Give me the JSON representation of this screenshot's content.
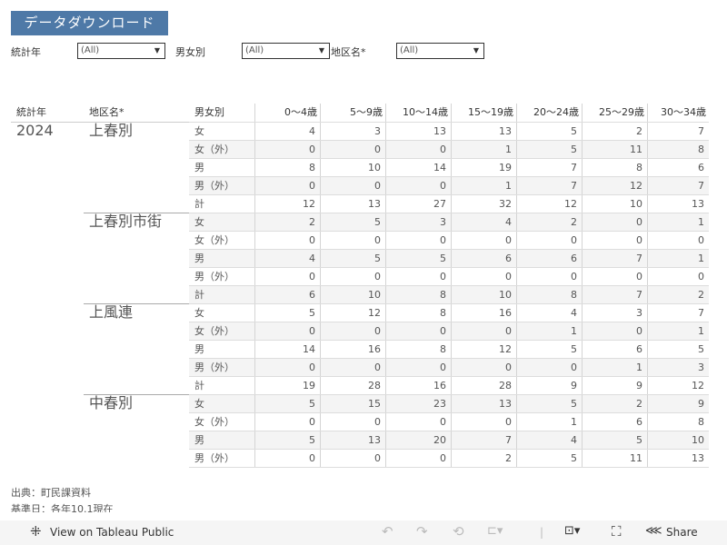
{
  "title_button": "データダウンロード",
  "filters": [
    {
      "label": "統計年",
      "value": "(All)"
    },
    {
      "label": "男女別",
      "value": "(All)"
    },
    {
      "label": "地区名*",
      "value": "(All)"
    }
  ],
  "table": {
    "headers": [
      "統計年",
      "地区名*",
      "男女別",
      "0～4歳",
      "5～9歳",
      "10～14歳",
      "15～19歳",
      "20～24歳",
      "25～29歳",
      "30～34歳"
    ],
    "year": "2024",
    "groups": [
      {
        "district": "上春別",
        "rows": [
          {
            "gender": "女",
            "values": [
              4,
              3,
              13,
              13,
              5,
              2,
              7
            ]
          },
          {
            "gender": "女（外）",
            "values": [
              0,
              0,
              0,
              1,
              5,
              11,
              8
            ]
          },
          {
            "gender": "男",
            "values": [
              8,
              10,
              14,
              19,
              7,
              8,
              6
            ]
          },
          {
            "gender": "男（外）",
            "values": [
              0,
              0,
              0,
              1,
              7,
              12,
              7
            ]
          },
          {
            "gender": "計",
            "values": [
              12,
              13,
              27,
              32,
              12,
              10,
              13
            ]
          }
        ]
      },
      {
        "district": "上春別市街",
        "rows": [
          {
            "gender": "女",
            "values": [
              2,
              5,
              3,
              4,
              2,
              0,
              1
            ]
          },
          {
            "gender": "女（外）",
            "values": [
              0,
              0,
              0,
              0,
              0,
              0,
              0
            ]
          },
          {
            "gender": "男",
            "values": [
              4,
              5,
              5,
              6,
              6,
              7,
              1
            ]
          },
          {
            "gender": "男（外）",
            "values": [
              0,
              0,
              0,
              0,
              0,
              0,
              0
            ]
          },
          {
            "gender": "計",
            "values": [
              6,
              10,
              8,
              10,
              8,
              7,
              2
            ]
          }
        ]
      },
      {
        "district": "上風連",
        "rows": [
          {
            "gender": "女",
            "values": [
              5,
              12,
              8,
              16,
              4,
              3,
              7
            ]
          },
          {
            "gender": "女（外）",
            "values": [
              0,
              0,
              0,
              0,
              1,
              0,
              1
            ]
          },
          {
            "gender": "男",
            "values": [
              14,
              16,
              8,
              12,
              5,
              6,
              5
            ]
          },
          {
            "gender": "男（外）",
            "values": [
              0,
              0,
              0,
              0,
              0,
              1,
              3
            ]
          },
          {
            "gender": "計",
            "values": [
              19,
              28,
              16,
              28,
              9,
              9,
              12
            ]
          }
        ]
      },
      {
        "district": "中春別",
        "rows": [
          {
            "gender": "女",
            "values": [
              5,
              15,
              23,
              13,
              5,
              2,
              9
            ]
          },
          {
            "gender": "女（外）",
            "values": [
              0,
              0,
              0,
              0,
              1,
              6,
              8
            ]
          },
          {
            "gender": "男",
            "values": [
              5,
              13,
              20,
              7,
              4,
              5,
              10
            ]
          },
          {
            "gender": "男（外）",
            "values": [
              0,
              0,
              0,
              2,
              5,
              11,
              13
            ]
          }
        ]
      }
    ]
  },
  "footer": {
    "source": "出典：町民課資料",
    "basis": "基準日：各年10.1現在"
  },
  "toolbar": {
    "view_label": "View on Tableau Public",
    "share_label": "Share"
  }
}
